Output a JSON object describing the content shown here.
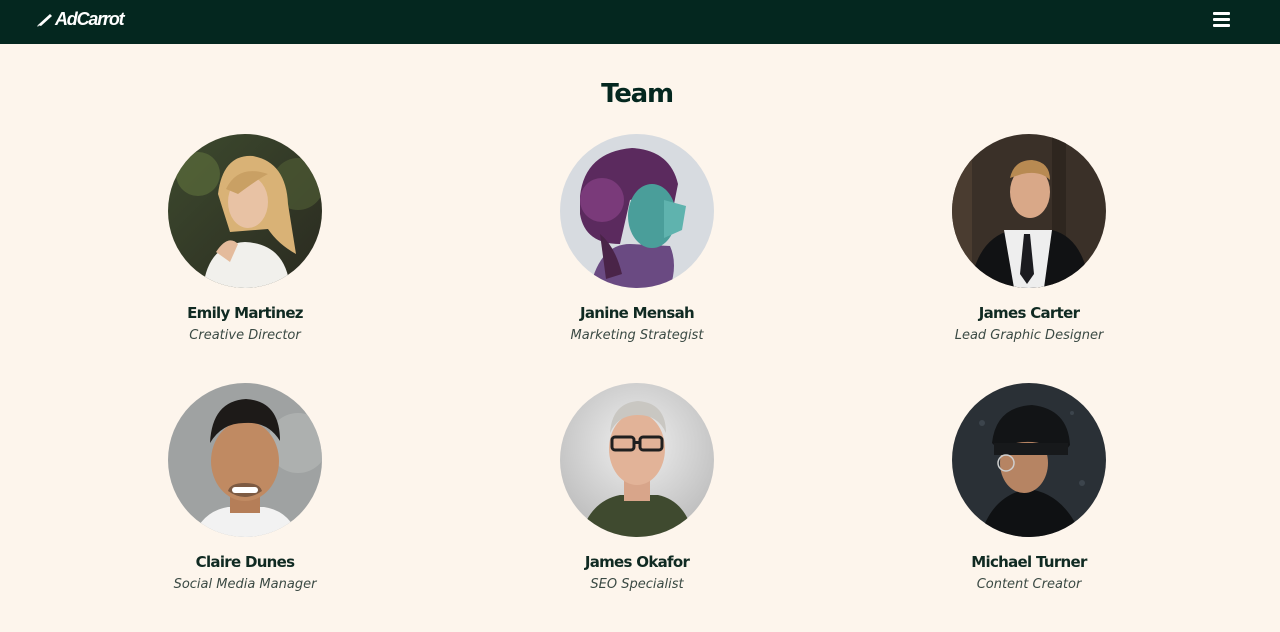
{
  "brand": {
    "name": "AdCarrot"
  },
  "nav": {
    "menu_icon": "hamburger-menu-icon"
  },
  "team": {
    "title": "Team",
    "members": [
      {
        "name": "Emily Martinez",
        "role": "Creative Director"
      },
      {
        "name": "Janine Mensah",
        "role": "Marketing Strategist"
      },
      {
        "name": "James Carter",
        "role": "Lead Graphic Designer"
      },
      {
        "name": "Claire Dunes",
        "role": "Social Media Manager"
      },
      {
        "name": "James Okafor",
        "role": "SEO Specialist"
      },
      {
        "name": "Michael Turner",
        "role": "Content Creator"
      }
    ]
  },
  "colors": {
    "navbar": "#04271f",
    "page_background": "#fdf5ec",
    "heading": "#04271f",
    "role_text": "#3b4a44"
  }
}
